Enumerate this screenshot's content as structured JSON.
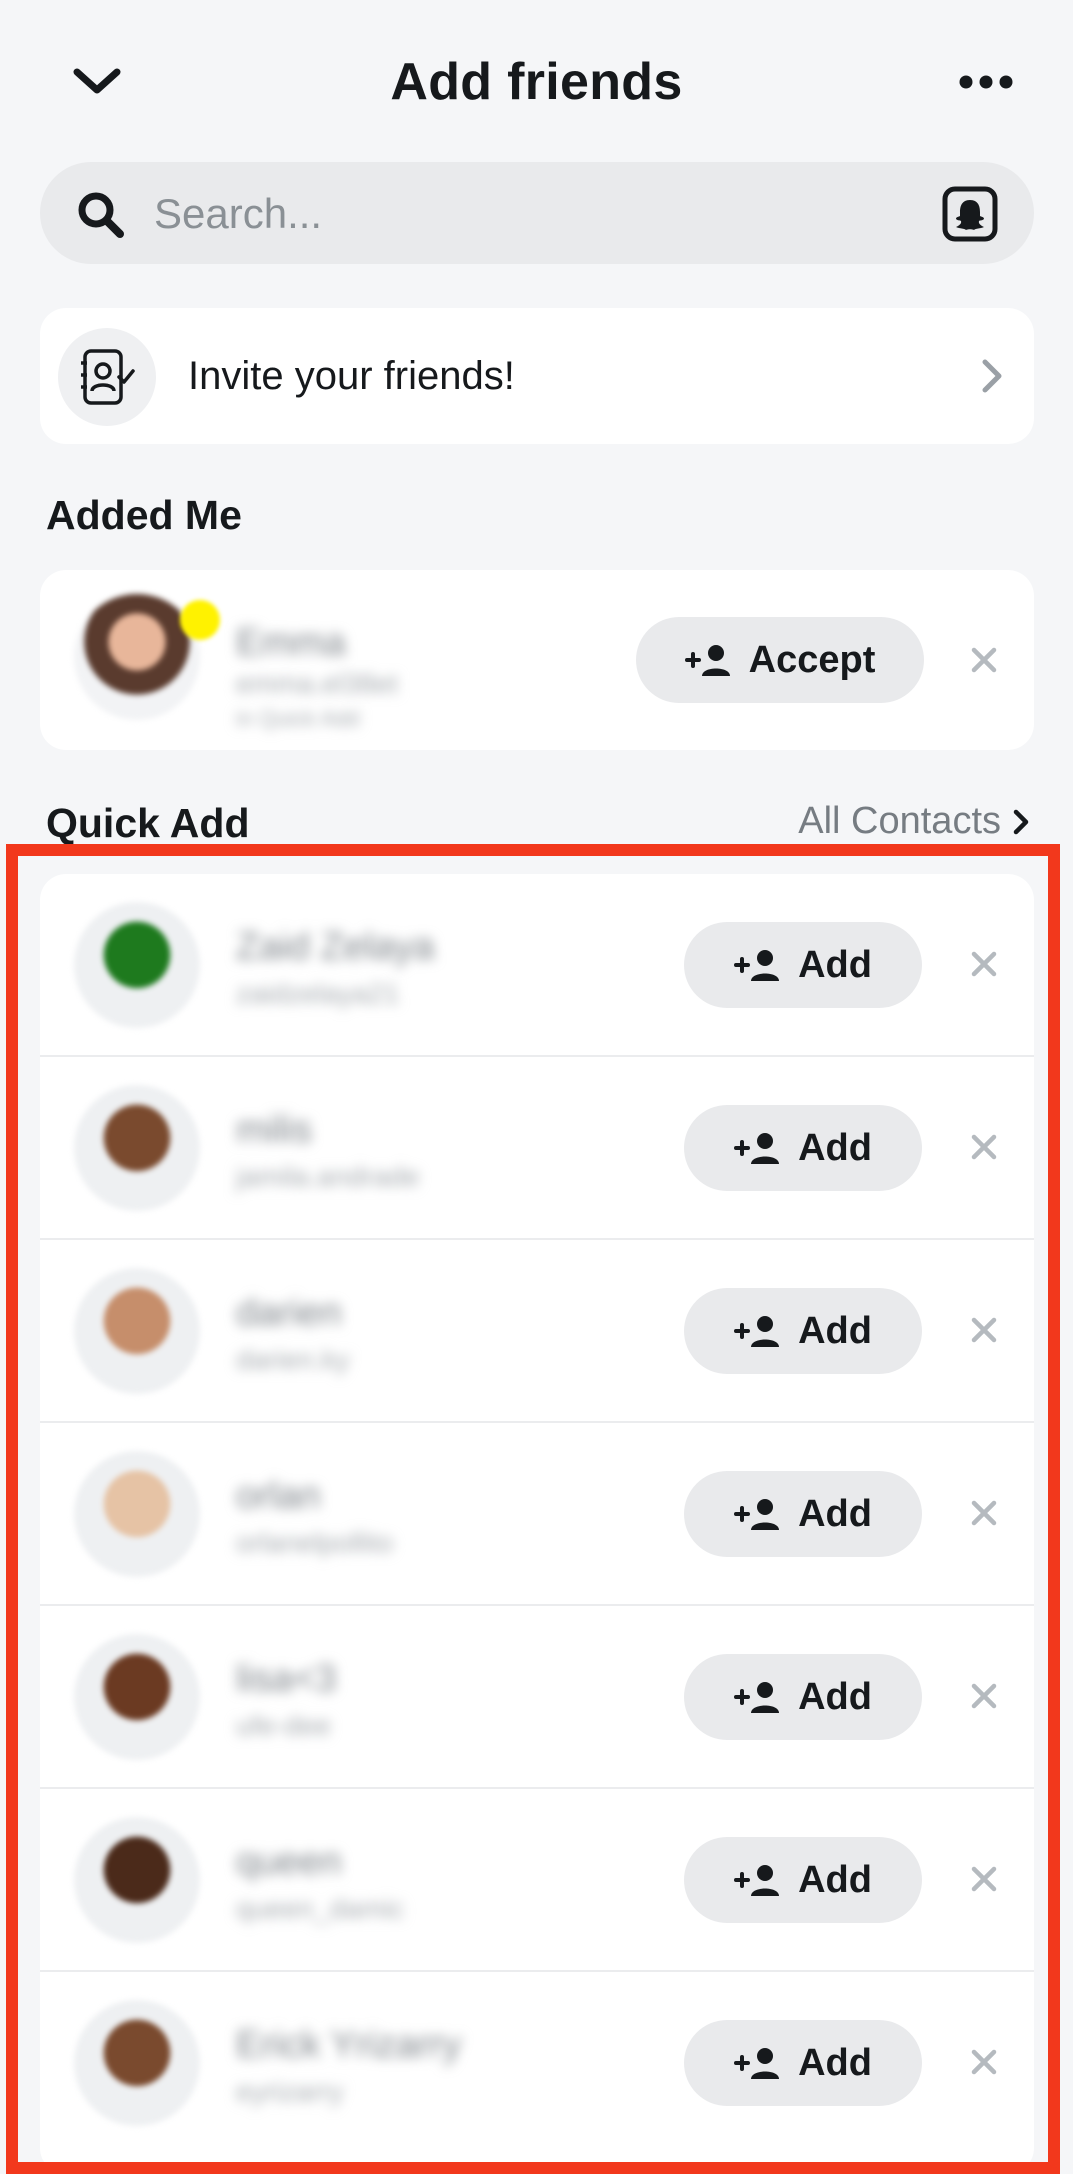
{
  "header": {
    "title": "Add friends",
    "back_icon": "chevron-down-icon",
    "more_icon": "more-horizontal-icon"
  },
  "search": {
    "placeholder": "Search...",
    "value": "",
    "search_icon": "search-icon",
    "scan_icon": "snapcode-scan-icon"
  },
  "invite": {
    "label": "Invite your friends!",
    "icon": "contact-invite-icon"
  },
  "added_me": {
    "title": "Added Me",
    "items": [
      {
        "name": "Emma",
        "username": "emma.el38et",
        "meta": "in Quick Add",
        "action": "Accept"
      }
    ]
  },
  "quick_add": {
    "title": "Quick Add",
    "all_contacts_label": "All Contacts",
    "add_label": "Add",
    "items": [
      {
        "name": "Zaid Zelaya",
        "username": "zaidzelaya21",
        "avatar_color": "#1E7A1E"
      },
      {
        "name": "milis",
        "username": "jamila.andrade",
        "avatar_color": "#7A4A2E"
      },
      {
        "name": "darien",
        "username": "darien.ky",
        "avatar_color": "#C68E6B"
      },
      {
        "name": "orlan",
        "username": "orlanelpollito",
        "avatar_color": "#E6C3A5"
      },
      {
        "name": "lisa<3",
        "username": "ufe-dee",
        "avatar_color": "#6B3A22"
      },
      {
        "name": "queen",
        "username": "queen_damic",
        "avatar_color": "#4B2A1A"
      },
      {
        "name": "Erick Yrizarry",
        "username": "eyrizarry",
        "avatar_color": "#7A4A2E"
      }
    ]
  },
  "colors": {
    "accent_highlight": "#F2381C",
    "background": "#F5F6F8",
    "pill": "#E9EAEC",
    "online_dot": "#FFF200"
  }
}
